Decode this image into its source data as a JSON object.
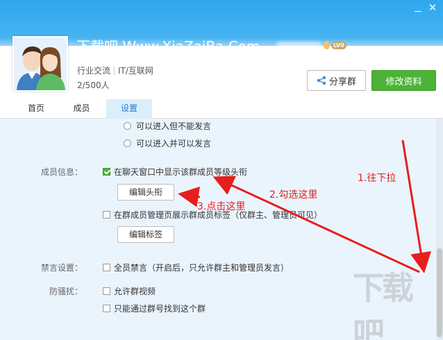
{
  "window": {
    "minimize_icon": "minimize-icon",
    "close_glyph": "✕"
  },
  "header": {
    "group_name": "下载吧 Www.XiaZaiBa.Com",
    "level_badge": "LV0",
    "category": "行业交流",
    "subcategory": "IT/互联网",
    "member_count": "2/500人",
    "share_label": "分享群",
    "edit_label": "修改资料"
  },
  "tabs": [
    {
      "label": "首页"
    },
    {
      "label": "成员"
    },
    {
      "label": "设置"
    }
  ],
  "settings": {
    "radio_options": [
      "可以进入但不能发言",
      "可以进入并可以发言"
    ],
    "member_info_label": "成员信息：",
    "show_level_label": "在聊天窗口中显示该群成员等级头衔",
    "edit_title_button": "编辑头衔",
    "show_tag_label": "在群成员管理页展示群成员标签（仅群主、管理员可见）",
    "edit_tag_button": "编辑标签",
    "mute_label": "禁言设置：",
    "mute_all_label": "全员禁言（开启后，只允许群主和管理员发言）",
    "anti_spam_label": "防骚扰：",
    "allow_video_label": "允许群视频",
    "search_only_label": "只能通过群号找到这个群"
  },
  "annotations": {
    "step1": "1.往下拉",
    "step2": "2.勾选这里",
    "step3": "3.点击这里"
  },
  "watermark": "下载吧",
  "colors": {
    "header_blue": "#2ea7ee",
    "edit_green": "#4cb336",
    "annotation_red": "#e81d1d",
    "content_bg": "#eaf4fd"
  }
}
